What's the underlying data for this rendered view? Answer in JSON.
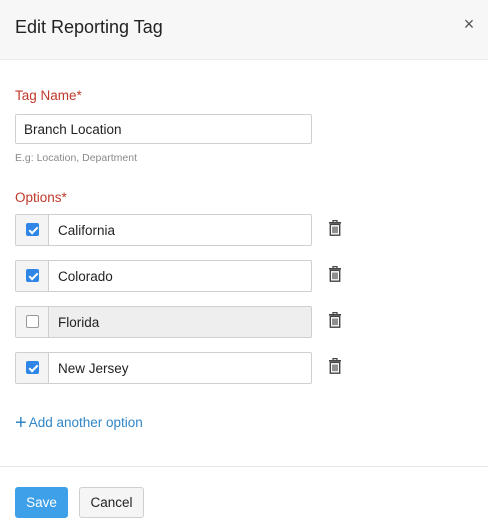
{
  "header": {
    "title": "Edit Reporting Tag",
    "close_symbol": "×"
  },
  "tag_name": {
    "label": "Tag Name",
    "required_marker": "*",
    "value": "Branch Location",
    "hint": "E.g: Location, Department"
  },
  "options": {
    "label": "Options",
    "required_marker": "*",
    "items": [
      {
        "text": "California",
        "checked": true
      },
      {
        "text": "Colorado",
        "checked": true
      },
      {
        "text": "Florida",
        "checked": false
      },
      {
        "text": "New Jersey",
        "checked": true
      }
    ]
  },
  "add_option": {
    "symbol": "+",
    "label": "Add another option"
  },
  "footer": {
    "save_label": "Save",
    "cancel_label": "Cancel"
  },
  "colors": {
    "accent": "#2f86e6",
    "save_button": "#3ea0e8",
    "label_red": "#c0392b",
    "link_blue": "#2f86c8"
  },
  "icons": [
    "close-icon",
    "check-icon",
    "trash-icon",
    "plus-icon"
  ]
}
